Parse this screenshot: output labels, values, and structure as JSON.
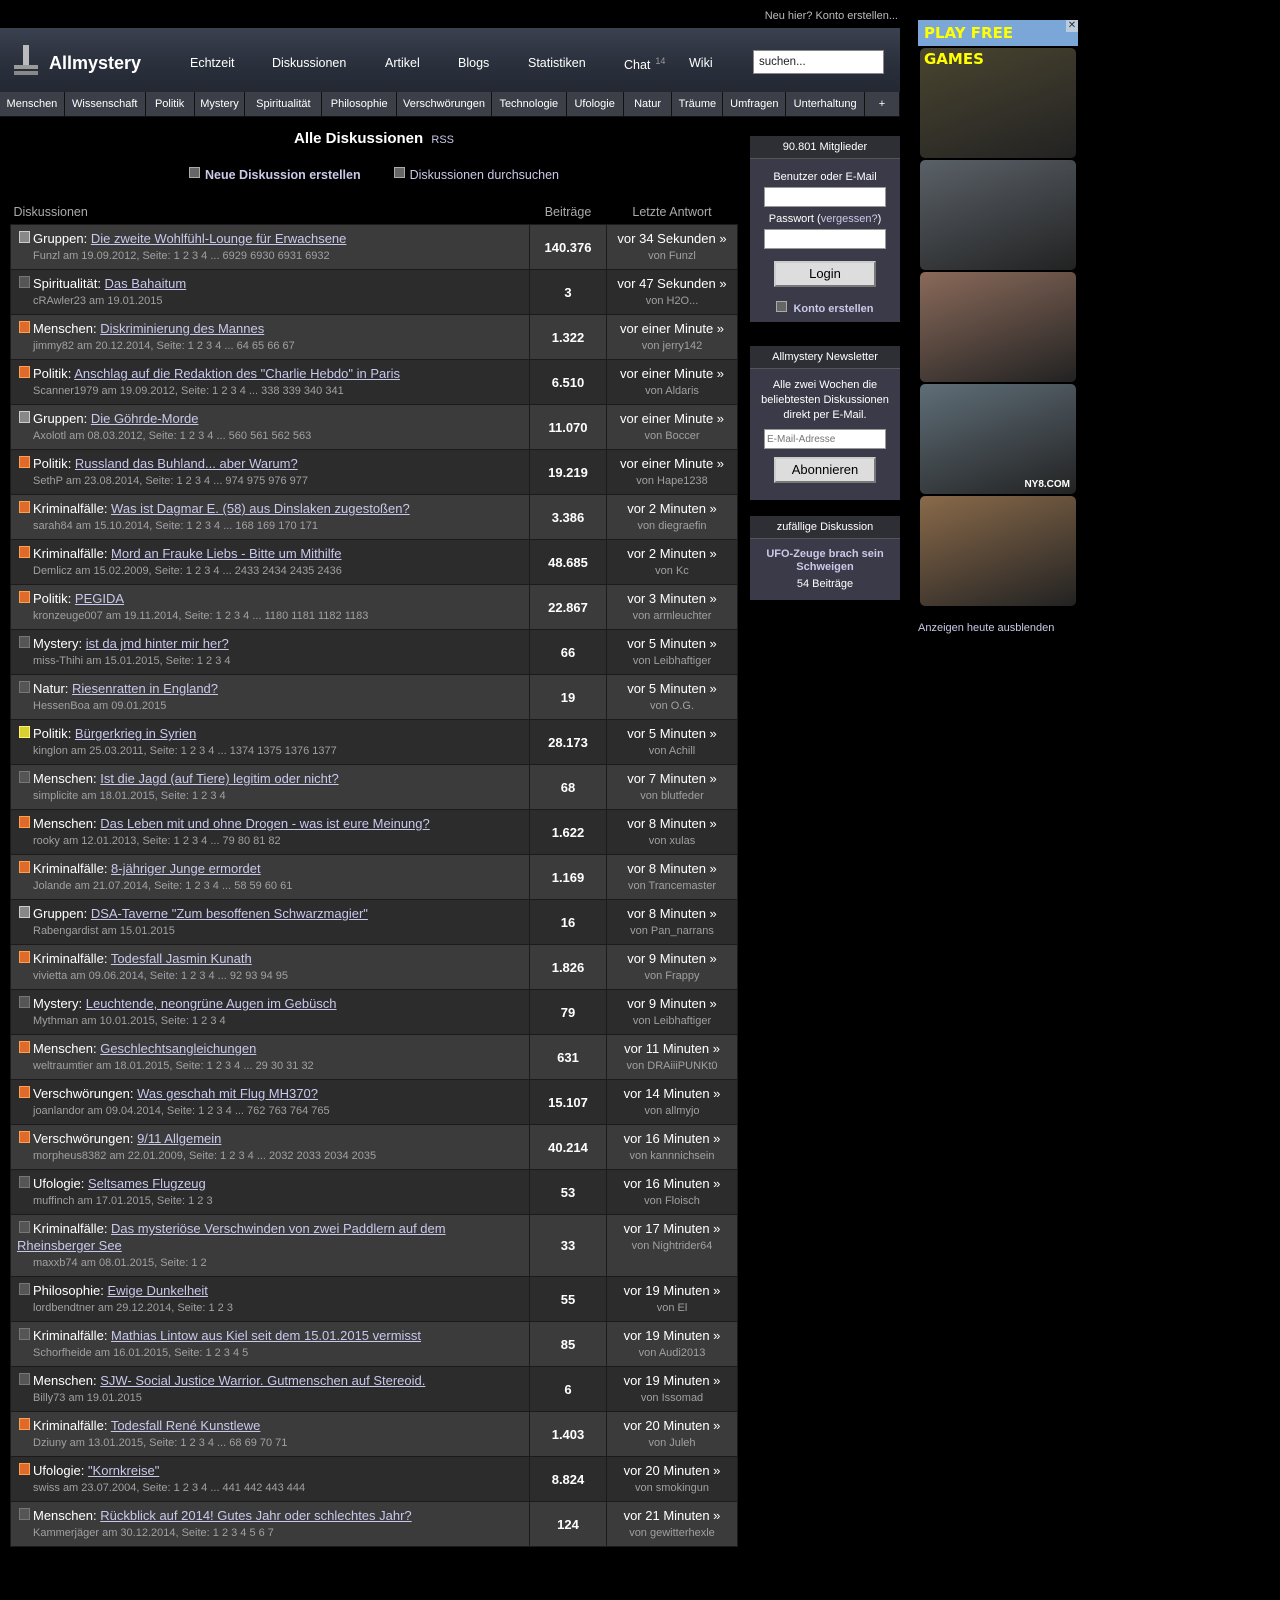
{
  "topbar": {
    "register_text": "Neu hier? Konto erstellen..."
  },
  "header": {
    "logo": "Allmystery",
    "nav": [
      {
        "label": "Echtzeit"
      },
      {
        "label": "Diskussionen"
      },
      {
        "label": "Artikel"
      },
      {
        "label": "Blogs"
      },
      {
        "label": "Statistiken"
      },
      {
        "label": "Chat",
        "badge": "14"
      },
      {
        "label": "Wiki"
      }
    ],
    "search_value": "suchen..."
  },
  "categories": [
    "Menschen",
    "Wissenschaft",
    "Politik",
    "Mystery",
    "Spiritualität",
    "Philosophie",
    "Verschwörungen",
    "Technologie",
    "Ufologie",
    "Natur",
    "Träume",
    "Umfragen",
    "Unterhaltung",
    "+"
  ],
  "main": {
    "title": "Alle Diskussionen",
    "rss": "RSS",
    "new_discussion": "Neue Diskussion erstellen",
    "search_discussions": "Diskussionen durchsuchen",
    "columns": {
      "topic": "Diskussionen",
      "posts": "Beiträge",
      "last": "Letzte Antwort"
    },
    "rows": [
      {
        "cat": "Gruppen",
        "title": "Die zweite Wohlfühl-Lounge für Erwachsene",
        "meta": "Funzl am 19.09.2012, Seite: 1 2 3 4 ... 6929 6930 6931 6932",
        "posts": "140.376",
        "last": "vor 34 Sekunden »",
        "by": "von Funzl",
        "icon": "grp"
      },
      {
        "cat": "Spiritualität",
        "title": "Das Bahaitum",
        "meta": "cRAwler23 am 19.01.2015",
        "posts": "3",
        "last": "vor 47 Sekunden »",
        "by": "von H2O...",
        "icon": "new"
      },
      {
        "cat": "Menschen",
        "title": "Diskriminierung des Mannes",
        "meta": "jimmy82 am 20.12.2014, Seite: 1 2 3 4 ... 64 65 66 67",
        "posts": "1.322",
        "last": "vor einer Minute »",
        "by": "von jerry142",
        "icon": "hot"
      },
      {
        "cat": "Politik",
        "title": "Anschlag auf die Redaktion des \"Charlie Hebdo\" in Paris",
        "meta": "Scanner1979 am 19.09.2012, Seite: 1 2 3 4 ... 338 339 340 341",
        "posts": "6.510",
        "last": "vor einer Minute »",
        "by": "von Aldaris",
        "icon": "hot"
      },
      {
        "cat": "Gruppen",
        "title": "Die Göhrde-Morde",
        "meta": "Axolotl am 08.03.2012, Seite: 1 2 3 4 ... 560 561 562 563",
        "posts": "11.070",
        "last": "vor einer Minute »",
        "by": "von Boccer",
        "icon": "grp"
      },
      {
        "cat": "Politik",
        "title": "Russland das Buhland... aber Warum?",
        "meta": "SethP am 23.08.2014, Seite: 1 2 3 4 ... 974 975 976 977",
        "posts": "19.219",
        "last": "vor einer Minute »",
        "by": "von Hape1238",
        "icon": "hot"
      },
      {
        "cat": "Kriminalfälle",
        "title": "Was ist Dagmar E. (58) aus Dinslaken zugestoßen?",
        "meta": "sarah84 am 15.10.2014, Seite: 1 2 3 4 ... 168 169 170 171",
        "posts": "3.386",
        "last": "vor 2 Minuten »",
        "by": "von diegraefin",
        "icon": "hot"
      },
      {
        "cat": "Kriminalfälle",
        "title": "Mord an Frauke Liebs - Bitte um Mithilfe",
        "meta": "Demlicz am 15.02.2009, Seite: 1 2 3 4 ... 2433 2434 2435 2436",
        "posts": "48.685",
        "last": "vor 2 Minuten »",
        "by": "von Kc",
        "icon": "hot"
      },
      {
        "cat": "Politik",
        "title": "PEGIDA",
        "meta": "kronzeuge007 am 19.11.2014, Seite: 1 2 3 4 ... 1180 1181 1182 1183",
        "posts": "22.867",
        "last": "vor 3 Minuten »",
        "by": "von armleuchter",
        "icon": "hot"
      },
      {
        "cat": "Mystery",
        "title": "ist da jmd hinter mir her?",
        "meta": "miss-Thihi am 15.01.2015, Seite: 1 2 3 4",
        "posts": "66",
        "last": "vor 5 Minuten »",
        "by": "von Leibhaftiger",
        "icon": "norm"
      },
      {
        "cat": "Natur",
        "title": "Riesenratten in England?",
        "meta": "HessenBoa am 09.01.2015",
        "posts": "19",
        "last": "vor 5 Minuten »",
        "by": "von O.G.",
        "icon": "norm"
      },
      {
        "cat": "Politik",
        "title": "Bürgerkrieg in Syrien",
        "meta": "kinglon am 25.03.2011, Seite: 1 2 3 4 ... 1374 1375 1376 1377",
        "posts": "28.173",
        "last": "vor 5 Minuten »",
        "by": "von Achill",
        "icon": "mid"
      },
      {
        "cat": "Menschen",
        "title": "Ist die Jagd (auf Tiere) legitim oder nicht?",
        "meta": "simplicite am 18.01.2015, Seite: 1 2 3 4",
        "posts": "68",
        "last": "vor 7 Minuten »",
        "by": "von blutfeder",
        "icon": "norm"
      },
      {
        "cat": "Menschen",
        "title": "Das Leben mit und ohne Drogen - was ist eure Meinung?",
        "meta": "rooky am 12.01.2013, Seite: 1 2 3 4 ... 79 80 81 82",
        "posts": "1.622",
        "last": "vor 8 Minuten »",
        "by": "von xulas",
        "icon": "hot"
      },
      {
        "cat": "Kriminalfälle",
        "title": "8-jähriger Junge ermordet",
        "meta": "Jolande am 21.07.2014, Seite: 1 2 3 4 ... 58 59 60 61",
        "posts": "1.169",
        "last": "vor 8 Minuten »",
        "by": "von Trancemaster",
        "icon": "hot"
      },
      {
        "cat": "Gruppen",
        "title": "DSA-Taverne \"Zum besoffenen Schwarzmagier\"",
        "meta": "Rabengardist am 15.01.2015",
        "posts": "16",
        "last": "vor 8 Minuten »",
        "by": "von Pan_narrans",
        "icon": "grp"
      },
      {
        "cat": "Kriminalfälle",
        "title": "Todesfall Jasmin Kunath",
        "meta": "vivietta am 09.06.2014, Seite: 1 2 3 4 ... 92 93 94 95",
        "posts": "1.826",
        "last": "vor 9 Minuten »",
        "by": "von Frappy",
        "icon": "hot"
      },
      {
        "cat": "Mystery",
        "title": "Leuchtende, neongrüne Augen im Gebüsch",
        "meta": "Mythman am 10.01.2015, Seite: 1 2 3 4",
        "posts": "79",
        "last": "vor 9 Minuten »",
        "by": "von Leibhaftiger",
        "icon": "norm"
      },
      {
        "cat": "Menschen",
        "title": "Geschlechtsangleichungen",
        "meta": "weltraumtier am 18.01.2015, Seite: 1 2 3 4 ... 29 30 31 32",
        "posts": "631",
        "last": "vor 11 Minuten »",
        "by": "von DRAiiiPUNKt0",
        "icon": "hot"
      },
      {
        "cat": "Verschwörungen",
        "title": "Was geschah mit Flug MH370?",
        "meta": "joanlandor am 09.04.2014, Seite: 1 2 3 4 ... 762 763 764 765",
        "posts": "15.107",
        "last": "vor 14 Minuten »",
        "by": "von allmyjo",
        "icon": "hot"
      },
      {
        "cat": "Verschwörungen",
        "title": "9/11 Allgemein",
        "meta": "morpheus8382 am 22.01.2009, Seite: 1 2 3 4 ... 2032 2033 2034 2035",
        "posts": "40.214",
        "last": "vor 16 Minuten »",
        "by": "von kannnichsein",
        "icon": "hot"
      },
      {
        "cat": "Ufologie",
        "title": "Seltsames Flugzeug",
        "meta": "muffinch am 17.01.2015, Seite: 1 2 3",
        "posts": "53",
        "last": "vor 16 Minuten »",
        "by": "von Floisch",
        "icon": "norm"
      },
      {
        "cat": "Kriminalfälle",
        "title": "Das mysteriöse Verschwinden von zwei Paddlern auf dem Rheinsberger See",
        "meta": "maxxb74 am 08.01.2015, Seite: 1 2",
        "posts": "33",
        "last": "vor 17 Minuten »",
        "by": "von Nightrider64",
        "icon": "norm"
      },
      {
        "cat": "Philosophie",
        "title": "Ewige Dunkelheit",
        "meta": "lordbendtner am 29.12.2014, Seite: 1 2 3",
        "posts": "55",
        "last": "vor 19 Minuten »",
        "by": "von El",
        "icon": "norm"
      },
      {
        "cat": "Kriminalfälle",
        "title": "Mathias Lintow aus Kiel seit dem 15.01.2015 vermisst",
        "meta": "Schorfheide am 16.01.2015, Seite: 1 2 3 4 5",
        "posts": "85",
        "last": "vor 19 Minuten »",
        "by": "von Audi2013",
        "icon": "norm"
      },
      {
        "cat": "Menschen",
        "title": "SJW- Social Justice Warrior. Gutmenschen auf Stereoid.",
        "meta": "Billy73 am 19.01.2015",
        "posts": "6",
        "last": "vor 19 Minuten »",
        "by": "von Issomad",
        "icon": "new"
      },
      {
        "cat": "Kriminalfälle",
        "title": "Todesfall René Kunstlewe",
        "meta": "Dziuny am 13.01.2015, Seite: 1 2 3 4 ... 68 69 70 71",
        "posts": "1.403",
        "last": "vor 20 Minuten »",
        "by": "von Juleh",
        "icon": "hot"
      },
      {
        "cat": "Ufologie",
        "title": "\"Kornkreise\"",
        "meta": "swiss am 23.07.2004, Seite: 1 2 3 4 ... 441 442 443 444",
        "posts": "8.824",
        "last": "vor 20 Minuten »",
        "by": "von smokingun",
        "icon": "hot"
      },
      {
        "cat": "Menschen",
        "title": "Rückblick auf 2014! Gutes Jahr oder schlechtes Jahr?",
        "meta": "Kammerjäger am 30.12.2014, Seite: 1 2 3 4 5 6 7",
        "posts": "124",
        "last": "vor 21 Minuten »",
        "by": "von gewitterhexle",
        "icon": "norm"
      }
    ]
  },
  "sidebar": {
    "members": "90.801 Mitglieder",
    "user_label": "Benutzer oder E-Mail",
    "password_label": "Passwort",
    "forgot": "vergessen?",
    "login": "Login",
    "create_account": "Konto erstellen",
    "newsletter_title": "Allmystery Newsletter",
    "newsletter_text": "Alle zwei Wochen die beliebtesten Diskussionen direkt per E-Mail.",
    "email_placeholder": "E-Mail-Adresse",
    "subscribe": "Abonnieren",
    "random_title": "zufällige Diskussion",
    "random_link": "UFO-Zeuge brach sein Schweigen",
    "random_count": "54 Beiträge"
  },
  "ads": {
    "banner": "PLAY FREE GAMES",
    "close": "✕",
    "watermark": "NY8.COM",
    "hide_link": "Anzeigen heute ausblenden",
    "colors": [
      "#4a4530",
      "#5a6168",
      "#8a6a5a",
      "#5f6e78",
      "#8a6a4a"
    ]
  }
}
